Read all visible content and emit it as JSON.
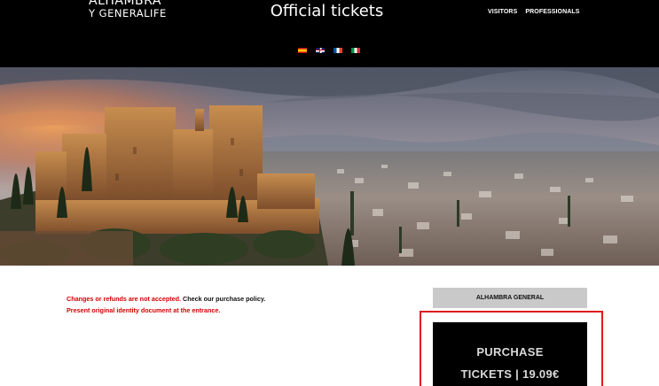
{
  "header": {
    "logo_line1": "ALHAMBRA",
    "logo_line2": "Y GENERALIFE",
    "title": "Official tickets",
    "nav": [
      "VISITORS",
      "PROFESSIONALS"
    ],
    "languages": [
      "es-flag-icon",
      "uk-flag-icon",
      "fr-flag-icon",
      "it-flag-icon"
    ]
  },
  "notice": {
    "line1_red": "Changes or refunds are not accepted.",
    "line1_black_a": "Check our",
    "line1_black_b": "purchase policy.",
    "line2_red": "Present original identity document at the entrance."
  },
  "tickets": {
    "tab_label": "ALHAMBRA GENERAL",
    "purchase_line1": "PURCHASE",
    "purchase_line2": "TICKETS | 19.09€"
  },
  "colors": {
    "header_bg": "#000000",
    "notice_red": "#d40000",
    "highlight_border": "#e01b1b",
    "tab_bg": "#c9c9c9"
  }
}
